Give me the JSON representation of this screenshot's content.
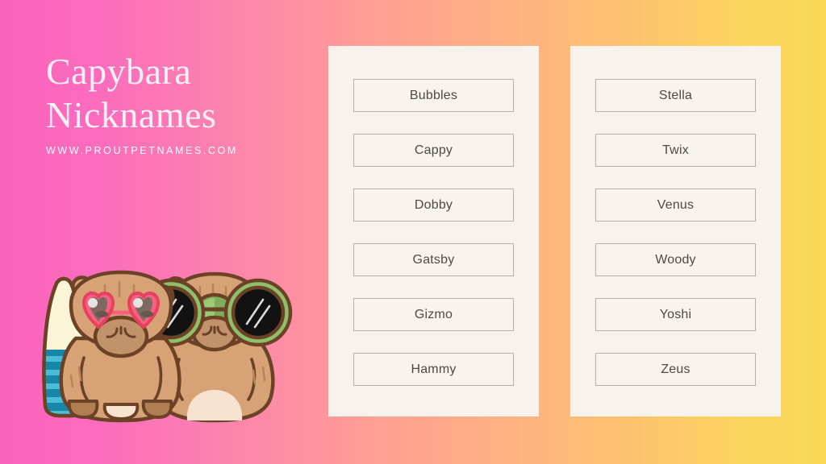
{
  "background": {
    "gradient_start": "#fb63bb",
    "gradient_mid": "#ffa092",
    "gradient_end": "#fad955"
  },
  "headline": {
    "line1": "Capybara",
    "line2": "Nicknames",
    "url": "WWW.PROUTPETNAMES.COM",
    "text_color": "#fdf0f6"
  },
  "panels": [
    {
      "names": [
        "Bubbles",
        "Cappy",
        "Dobby",
        "Gatsby",
        "Gizmo",
        "Hammy"
      ]
    },
    {
      "names": [
        "Stella",
        "Twix",
        "Venus",
        "Woody",
        "Yoshi",
        "Zeus"
      ]
    },
    {
      "names": [
        "",
        "",
        "",
        "",
        "",
        ""
      ]
    }
  ],
  "illustration": {
    "description": "two cartoon capybaras with sunglasses and a surfboard",
    "fur_color": "#d7a276",
    "outline_color": "#6b4226",
    "left_glasses_color": "#f4627f",
    "right_glasses_color": "#8fbf6a",
    "surfboard_top_color": "#fbf5d8",
    "surfboard_stripe_color": "#1787a8"
  }
}
